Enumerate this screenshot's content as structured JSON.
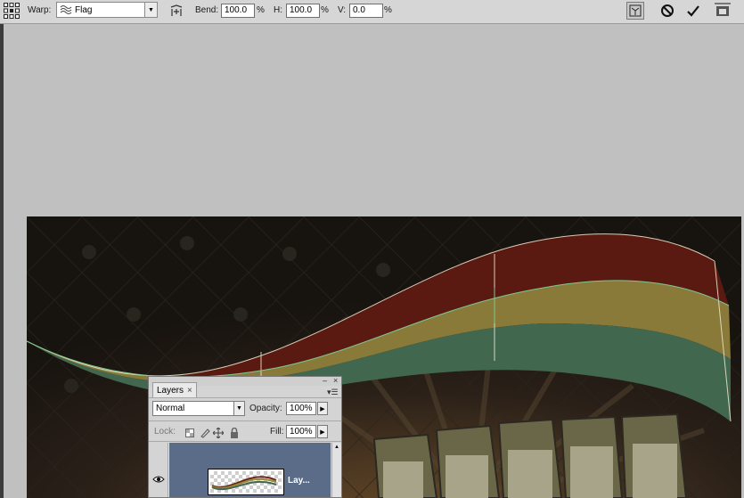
{
  "options_bar": {
    "warp_label": "Warp:",
    "warp_style": "Flag",
    "bend_label": "Bend:",
    "bend_value": "100.0",
    "bend_unit": "%",
    "h_label": "H:",
    "h_value": "100.0",
    "h_unit": "%",
    "v_label": "V:",
    "v_value": "0.0",
    "v_unit": "%"
  },
  "layers_panel": {
    "tab_title": "Layers",
    "tab_close": "×",
    "blend_mode": "Normal",
    "opacity_label": "Opacity:",
    "opacity_value": "100%",
    "lock_label": "Lock:",
    "fill_label": "Fill:",
    "fill_value": "100%",
    "layer_name": "Lay...",
    "minimize_glyph": "–",
    "close_glyph": "×",
    "menu_glyph": "▾☰"
  },
  "colors": {
    "ribbon_red": "#5a1a12",
    "ribbon_gold": "#8a7a3a",
    "ribbon_green": "#41684e",
    "selection_blue": "#5a6c88"
  }
}
